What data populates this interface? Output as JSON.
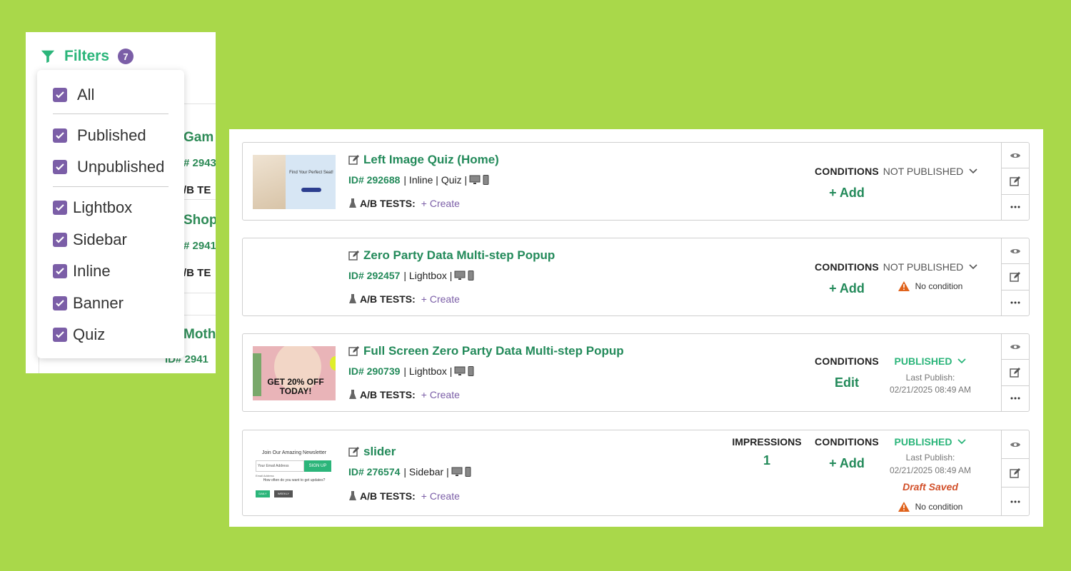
{
  "filters": {
    "title": "Filters",
    "count": "7",
    "options": [
      {
        "label": "All",
        "checked": true
      },
      {
        "label": "Published",
        "checked": true
      },
      {
        "label": "Unpublished",
        "checked": true
      },
      {
        "label": "Lightbox",
        "checked": true
      },
      {
        "label": "Sidebar",
        "checked": true
      },
      {
        "label": "Inline",
        "checked": true
      },
      {
        "label": "Banner",
        "checked": true
      },
      {
        "label": "Quiz",
        "checked": true
      }
    ],
    "background": [
      {
        "name": "Gam",
        "id": "# 2943",
        "ab": "/B TE"
      },
      {
        "name": "Shop",
        "id": "# 2941",
        "ab": "/B TE"
      },
      {
        "name": "Moth",
        "id": "ID# 2941"
      }
    ]
  },
  "labels": {
    "conditions": "CONDITIONS",
    "impressions": "IMPRESSIONS",
    "ab_tests": "A/B TESTS:",
    "create": "+ Create",
    "add": "+ Add",
    "edit": "Edit",
    "last_publish": "Last Publish:",
    "no_condition": "No condition",
    "draft_saved": "Draft Saved"
  },
  "campaigns": [
    {
      "title": "Left Image Quiz (Home)",
      "id": "ID# 292688",
      "type": "| Inline | Quiz |",
      "status": "NOT PUBLISHED",
      "conditions_action": "+ Add",
      "thumb_text": "Find Your Perfect Seat!"
    },
    {
      "title": "Zero Party Data Multi-step Popup",
      "id": "ID# 292457",
      "type": "| Lightbox |",
      "status": "NOT PUBLISHED",
      "conditions_action": "+ Add",
      "warning": "No condition"
    },
    {
      "title": "Full Screen Zero Party Data Multi-step Popup",
      "id": "ID# 290739",
      "type": "| Lightbox |",
      "status": "PUBLISHED",
      "conditions_action": "Edit",
      "last_publish": "02/21/2025 08:49 AM",
      "thumb_text": "GET 20% OFF TODAY!"
    },
    {
      "title": "slider",
      "id": "ID# 276574",
      "type": "| Sidebar |",
      "status": "PUBLISHED",
      "conditions_action": "+ Add",
      "impressions": "1",
      "last_publish": "02/21/2025 08:49 AM",
      "draft": "Draft Saved",
      "warning": "No condition",
      "thumb": {
        "heading": "Join Our Amazing Newsletter",
        "placeholder": "Your Email Address",
        "button": "SIGN UP",
        "field_label": "Email Address",
        "question": "How often do you want to get updates?",
        "opt1": "DAILY",
        "opt2": "WEEKLY"
      }
    }
  ],
  "colors": {
    "brand_green": "#238a5a",
    "accent_purple": "#7b5ea7",
    "warning_orange": "#e0631c",
    "background": "#a9d84a"
  }
}
